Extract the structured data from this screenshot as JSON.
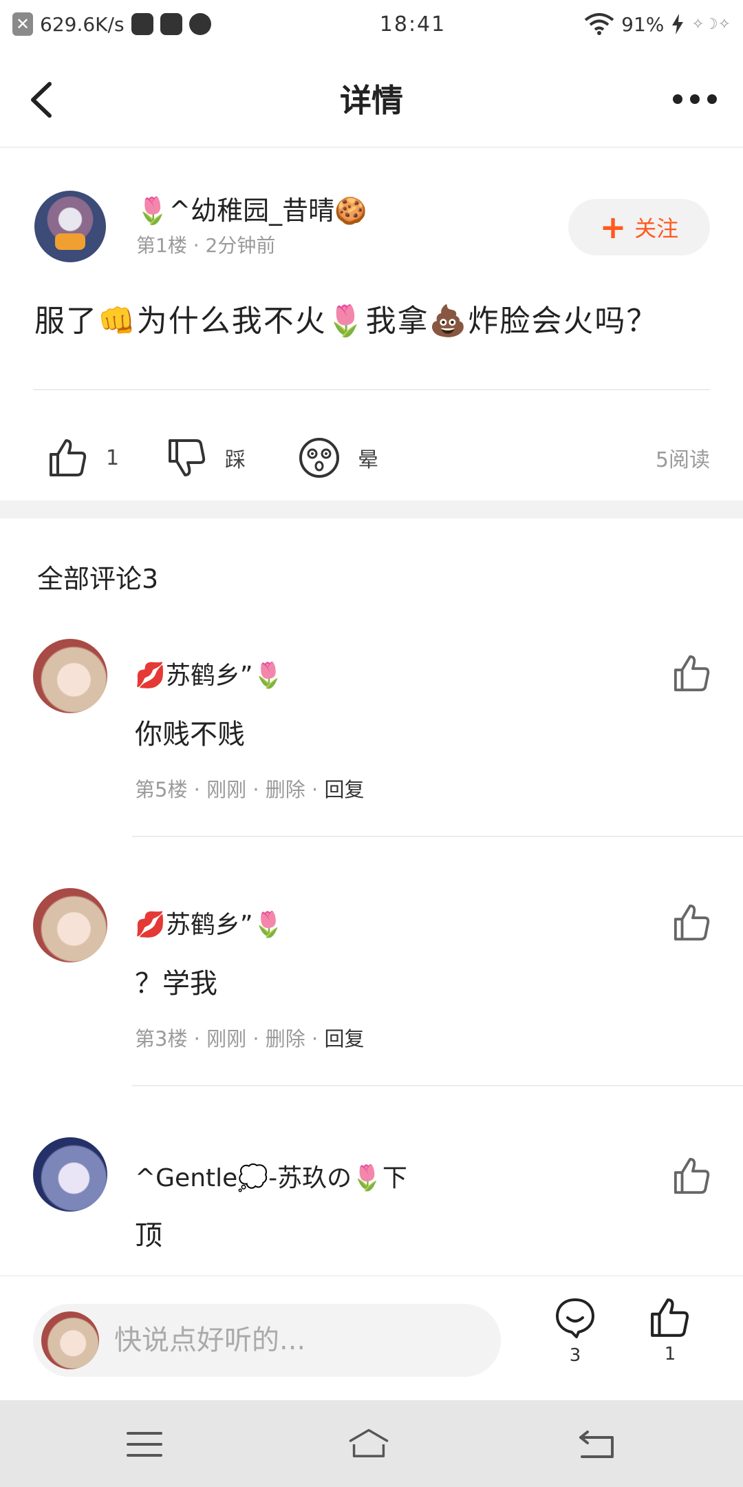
{
  "status_bar": {
    "speed": "629.6K/s",
    "time": "18:41",
    "battery": "91%",
    "deco": "✧☽✧"
  },
  "header": {
    "title": "详情"
  },
  "post": {
    "author": "🌷^幼稚园_昔晴🍪",
    "meta": "第1楼 · 2分钟前",
    "follow_label": "关注",
    "text": "服了👊为什么我不火🌷我拿💩炸脸会火吗？",
    "like_count": "1",
    "dislike_label": "踩",
    "dizzy_label": "晕",
    "read_count": "5阅读"
  },
  "comments_section": {
    "title": "全部评论3",
    "comments": [
      {
        "author": "💋苏鹤乡”🌷",
        "text": "你贱不贱",
        "floor": "第5楼",
        "time": "刚刚",
        "delete": "删除",
        "reply": "回复"
      },
      {
        "author": "💋苏鹤乡”🌷",
        "text": "？学我",
        "floor": "第3楼",
        "time": "刚刚",
        "delete": "删除",
        "reply": "回复"
      },
      {
        "author": "^Gentle💭-苏玖の🌷下",
        "text": "顶"
      }
    ]
  },
  "input_bar": {
    "placeholder": "快说点好听的...",
    "comment_count": "3",
    "like_count": "1"
  },
  "colors": {
    "accent": "#ff5a1f",
    "meta_gray": "#9a9a9a",
    "background_band": "#f2f2f2"
  }
}
